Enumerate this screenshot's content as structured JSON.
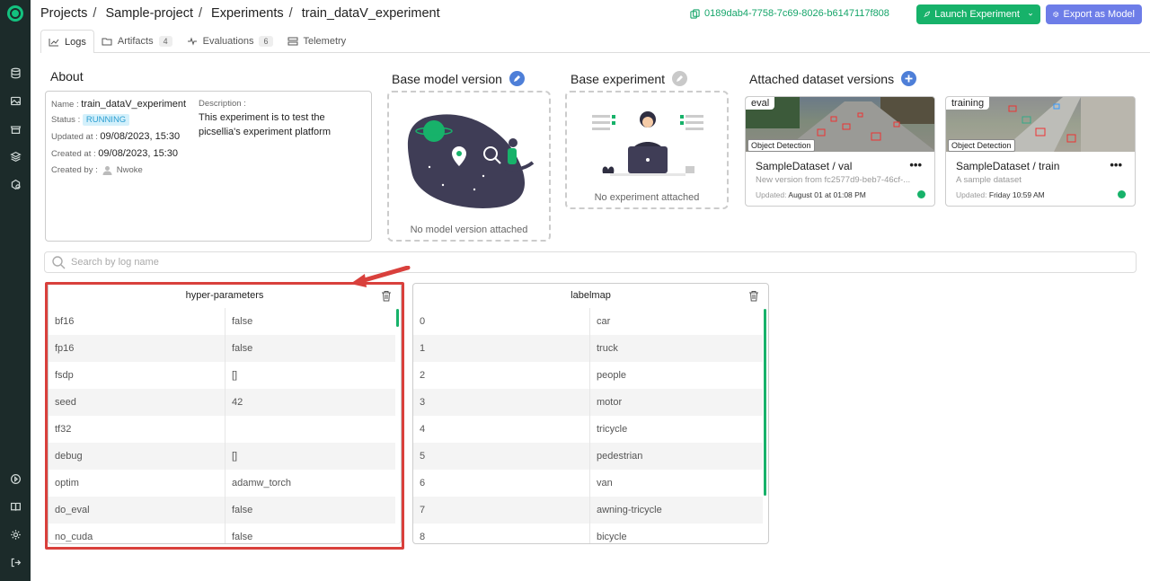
{
  "breadcrumb": [
    "Projects",
    "Sample-project",
    "Experiments",
    "train_dataV_experiment"
  ],
  "header": {
    "uuid": "0189dab4-7758-7c69-8026-b6147117f808",
    "launch_label": "Launch Experiment",
    "export_label": "Export as Model"
  },
  "tabs": [
    {
      "label": "Logs",
      "count": ""
    },
    {
      "label": "Artifacts",
      "count": "4"
    },
    {
      "label": "Evaluations",
      "count": "6"
    },
    {
      "label": "Telemetry",
      "count": ""
    }
  ],
  "about": {
    "title": "About",
    "name_label": "Name :",
    "name": "train_dataV_experiment",
    "status_label": "Status :",
    "status": "RUNNING",
    "updated_label": "Updated at :",
    "updated": "09/08/2023, 15:30",
    "created_label": "Created at :",
    "created": "09/08/2023, 15:30",
    "created_by_label": "Created by :",
    "created_by": "Nwoke",
    "description_label": "Description :",
    "description": "This experiment is to test the picsellia's experiment platform"
  },
  "base_model": {
    "title": "Base model version",
    "empty": "No model version attached"
  },
  "base_experiment": {
    "title": "Base experiment",
    "empty": "No experiment attached"
  },
  "datasets": {
    "title": "Attached dataset versions",
    "items": [
      {
        "tag": "eval",
        "type": "Object Detection",
        "name": "SampleDataset / val",
        "description": "New version from fc2577d9-beb7-46cf-...",
        "updated_label": "Updated:",
        "updated": "August 01 at 01:08 PM"
      },
      {
        "tag": "training",
        "type": "Object Detection",
        "name": "SampleDataset / train",
        "description": "A sample dataset",
        "updated_label": "Updated:",
        "updated": "Friday 10:59 AM"
      }
    ]
  },
  "search": {
    "placeholder": "Search by log name"
  },
  "logs": [
    {
      "title": "hyper-parameters",
      "rows": [
        [
          "bf16",
          "false"
        ],
        [
          "fp16",
          "false"
        ],
        [
          "fsdp",
          "[]"
        ],
        [
          "seed",
          "42"
        ],
        [
          "tf32",
          ""
        ],
        [
          "debug",
          "[]"
        ],
        [
          "optim",
          "adamw_torch"
        ],
        [
          "do_eval",
          "false"
        ],
        [
          "no_cuda",
          "false"
        ]
      ]
    },
    {
      "title": "labelmap",
      "rows": [
        [
          "0",
          "car"
        ],
        [
          "1",
          "truck"
        ],
        [
          "2",
          "people"
        ],
        [
          "3",
          "motor"
        ],
        [
          "4",
          "tricycle"
        ],
        [
          "5",
          "pedestrian"
        ],
        [
          "6",
          "van"
        ],
        [
          "7",
          "awning-tricycle"
        ],
        [
          "8",
          "bicycle"
        ]
      ]
    }
  ],
  "colors": {
    "brand": "#17b26a",
    "export": "#6d7de8",
    "highlight": "#d9403c",
    "sidebar": "#1c2b2a"
  }
}
